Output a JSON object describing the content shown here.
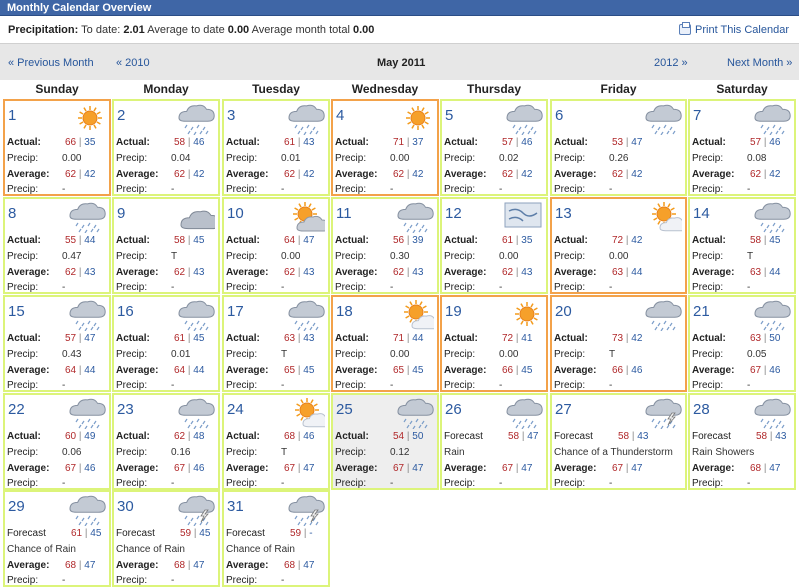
{
  "title": "Monthly Calendar Overview",
  "precip": {
    "label": "Precipitation:",
    "to_date_label": "To date:",
    "to_date": "2.01",
    "avg_to_date_label": "Average to date",
    "avg_to_date": "0.00",
    "avg_month_label": "Average month total",
    "avg_month": "0.00"
  },
  "print_label": "Print This Calendar",
  "nav": {
    "prev_month": "« Previous Month",
    "prev_year": "« 2010",
    "current": "May 2011",
    "next_year": "2012 »",
    "next_month": "Next Month »"
  },
  "weekdays": [
    "Sunday",
    "Monday",
    "Tuesday",
    "Wednesday",
    "Thursday",
    "Friday",
    "Saturday"
  ],
  "labels": {
    "actual": "Actual:",
    "precip": "Precip:",
    "average": "Average:",
    "forecast": "Forecast"
  },
  "colors": {
    "accent_border": "#dcf47a",
    "hot_border": "#f3a24a",
    "high": "#b0282a",
    "low": "#2c5aa0",
    "header": "#3f66a6"
  },
  "days": [
    {
      "day": "1",
      "kind": "actual",
      "icon": "sun-icon",
      "hot": true,
      "hi": "66",
      "lo": "35",
      "precip": "0.00",
      "avg_hi": "62",
      "avg_lo": "42"
    },
    {
      "day": "2",
      "kind": "actual",
      "icon": "rain-icon",
      "hi": "58",
      "lo": "46",
      "precip": "0.04",
      "avg_hi": "62",
      "avg_lo": "42"
    },
    {
      "day": "3",
      "kind": "actual",
      "icon": "rain-icon",
      "hi": "61",
      "lo": "43",
      "precip": "0.01",
      "avg_hi": "62",
      "avg_lo": "42"
    },
    {
      "day": "4",
      "kind": "actual",
      "icon": "sun-icon",
      "hot": true,
      "hi": "71",
      "lo": "37",
      "precip": "0.00",
      "avg_hi": "62",
      "avg_lo": "42"
    },
    {
      "day": "5",
      "kind": "actual",
      "icon": "rain-icon",
      "hi": "57",
      "lo": "46",
      "precip": "0.02",
      "avg_hi": "62",
      "avg_lo": "42"
    },
    {
      "day": "6",
      "kind": "actual",
      "icon": "rain-icon",
      "hi": "53",
      "lo": "47",
      "precip": "0.26",
      "avg_hi": "62",
      "avg_lo": "42"
    },
    {
      "day": "7",
      "kind": "actual",
      "icon": "rain-icon",
      "hi": "57",
      "lo": "46",
      "precip": "0.08",
      "avg_hi": "62",
      "avg_lo": "42"
    },
    {
      "day": "8",
      "kind": "actual",
      "icon": "rain-icon",
      "hi": "55",
      "lo": "44",
      "precip": "0.47",
      "avg_hi": "62",
      "avg_lo": "43"
    },
    {
      "day": "9",
      "kind": "actual",
      "icon": "cloud-icon",
      "hi": "58",
      "lo": "45",
      "precip": "T",
      "avg_hi": "62",
      "avg_lo": "43"
    },
    {
      "day": "10",
      "kind": "actual",
      "icon": "partly-cloudy-icon",
      "hi": "64",
      "lo": "47",
      "precip": "0.00",
      "avg_hi": "62",
      "avg_lo": "43"
    },
    {
      "day": "11",
      "kind": "actual",
      "icon": "rain-icon",
      "hi": "56",
      "lo": "39",
      "precip": "0.30",
      "avg_hi": "62",
      "avg_lo": "43"
    },
    {
      "day": "12",
      "kind": "actual",
      "icon": "wind-icon",
      "hi": "61",
      "lo": "35",
      "precip": "0.00",
      "avg_hi": "62",
      "avg_lo": "43"
    },
    {
      "day": "13",
      "kind": "actual",
      "icon": "sun-cloud-icon",
      "hot": true,
      "hi": "72",
      "lo": "42",
      "precip": "0.00",
      "avg_hi": "63",
      "avg_lo": "44"
    },
    {
      "day": "14",
      "kind": "actual",
      "icon": "rain-icon",
      "hi": "58",
      "lo": "45",
      "precip": "T",
      "avg_hi": "63",
      "avg_lo": "44"
    },
    {
      "day": "15",
      "kind": "actual",
      "icon": "rain-icon",
      "hi": "57",
      "lo": "47",
      "precip": "0.43",
      "avg_hi": "64",
      "avg_lo": "44"
    },
    {
      "day": "16",
      "kind": "actual",
      "icon": "rain-icon",
      "hi": "61",
      "lo": "45",
      "precip": "0.01",
      "avg_hi": "64",
      "avg_lo": "44"
    },
    {
      "day": "17",
      "kind": "actual",
      "icon": "rain-icon",
      "hi": "63",
      "lo": "43",
      "precip": "T",
      "avg_hi": "65",
      "avg_lo": "45"
    },
    {
      "day": "18",
      "kind": "actual",
      "icon": "sun-cloud-icon",
      "hot": true,
      "hi": "71",
      "lo": "44",
      "precip": "0.00",
      "avg_hi": "65",
      "avg_lo": "45"
    },
    {
      "day": "19",
      "kind": "actual",
      "icon": "sun-icon",
      "hot": true,
      "hi": "72",
      "lo": "41",
      "precip": "0.00",
      "avg_hi": "66",
      "avg_lo": "45"
    },
    {
      "day": "20",
      "kind": "actual",
      "icon": "rain-icon",
      "hot": true,
      "hi": "73",
      "lo": "42",
      "precip": "T",
      "avg_hi": "66",
      "avg_lo": "46"
    },
    {
      "day": "21",
      "kind": "actual",
      "icon": "rain-icon",
      "hi": "63",
      "lo": "50",
      "precip": "0.05",
      "avg_hi": "67",
      "avg_lo": "46"
    },
    {
      "day": "22",
      "kind": "actual",
      "icon": "rain-icon",
      "hi": "60",
      "lo": "49",
      "precip": "0.06",
      "avg_hi": "67",
      "avg_lo": "46"
    },
    {
      "day": "23",
      "kind": "actual",
      "icon": "rain-icon",
      "hi": "62",
      "lo": "48",
      "precip": "0.16",
      "avg_hi": "67",
      "avg_lo": "46"
    },
    {
      "day": "24",
      "kind": "actual",
      "icon": "sun-cloud-icon",
      "hi": "68",
      "lo": "46",
      "precip": "T",
      "avg_hi": "67",
      "avg_lo": "47"
    },
    {
      "day": "25",
      "kind": "actual",
      "icon": "rain-icon",
      "today": true,
      "hi": "54",
      "lo": "50",
      "precip": "0.12",
      "avg_hi": "67",
      "avg_lo": "47"
    },
    {
      "day": "26",
      "kind": "forecast",
      "icon": "rain-icon",
      "hi": "58",
      "lo": "47",
      "cond": "Rain",
      "avg_hi": "67",
      "avg_lo": "47",
      "precip": "-"
    },
    {
      "day": "27",
      "kind": "forecast",
      "icon": "thunder-icon",
      "hi": "58",
      "lo": "43",
      "cond": "Chance of a Thunderstorm",
      "avg_hi": "67",
      "avg_lo": "47",
      "precip": "-"
    },
    {
      "day": "28",
      "kind": "forecast",
      "icon": "rain-icon",
      "hi": "58",
      "lo": "43",
      "cond": "Rain Showers",
      "avg_hi": "68",
      "avg_lo": "47",
      "precip": "-"
    },
    {
      "day": "29",
      "kind": "forecast",
      "icon": "rain-icon",
      "hi": "61",
      "lo": "45",
      "cond": "Chance of Rain",
      "avg_hi": "68",
      "avg_lo": "47",
      "precip": "-"
    },
    {
      "day": "30",
      "kind": "forecast",
      "icon": "thunder-icon",
      "hi": "59",
      "lo": "45",
      "cond": "Chance of Rain",
      "avg_hi": "68",
      "avg_lo": "47",
      "precip": "-"
    },
    {
      "day": "31",
      "kind": "forecast",
      "icon": "thunder-icon",
      "hi": "59",
      "lo": "-",
      "cond": "Chance of Rain",
      "avg_hi": "68",
      "avg_lo": "47",
      "precip": "-"
    }
  ]
}
